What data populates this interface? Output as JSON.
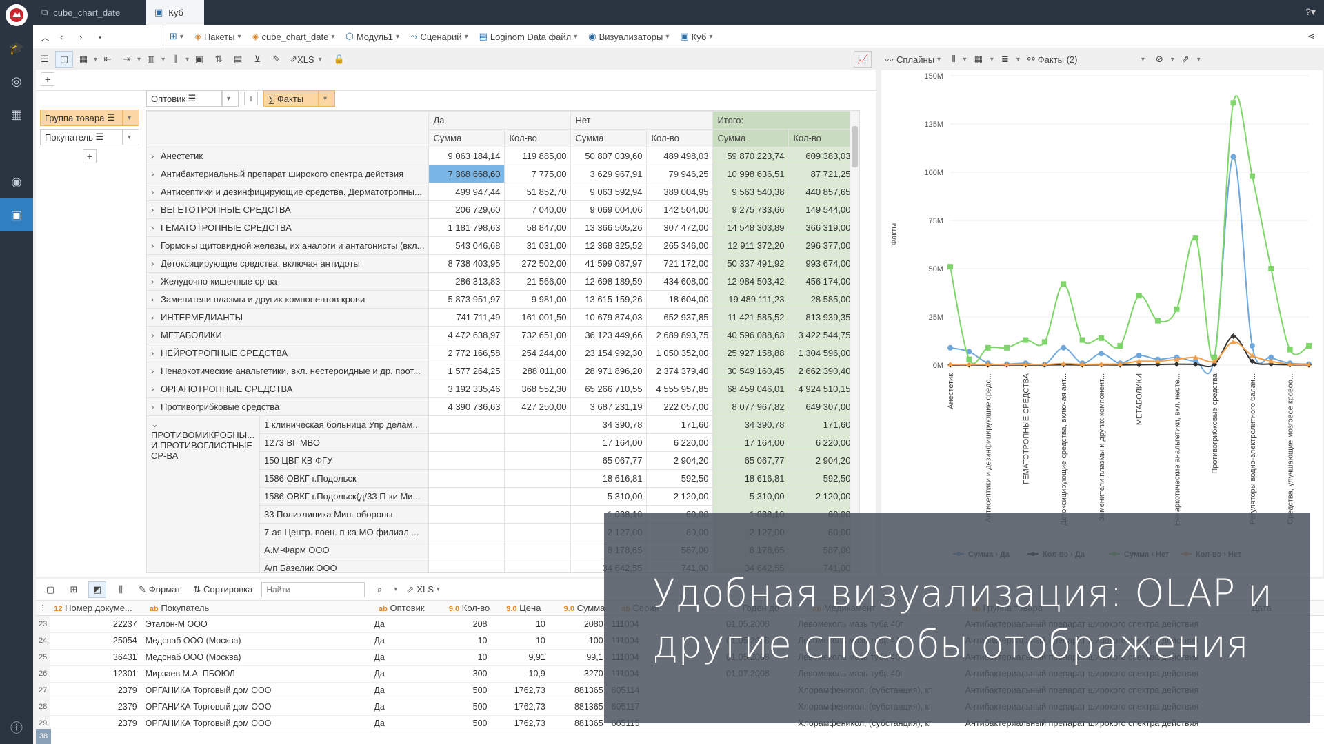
{
  "tabs": [
    {
      "label": "cube_chart_date"
    },
    {
      "label": "Куб"
    }
  ],
  "breadcrumbs": [
    {
      "label": "Пакеты",
      "icon": "package-icon"
    },
    {
      "label": "cube_chart_date",
      "icon": "package-icon"
    },
    {
      "label": "Модуль1",
      "icon": "module-icon"
    },
    {
      "label": "Сценарий",
      "icon": "scenario-icon"
    },
    {
      "label": "Loginom Data файл",
      "icon": "file-icon"
    },
    {
      "label": "Визуализаторы",
      "icon": "eye-icon"
    },
    {
      "label": "Куб",
      "icon": "cube-icon"
    }
  ],
  "toolbar2": {
    "xls": "XLS"
  },
  "pivot": {
    "filters": {
      "optovik": "Оптовик",
      "facts": "∑ Факты"
    },
    "row_dims": {
      "group": "Группа товара",
      "buyer": "Покупатель"
    },
    "col_groups": [
      "Да",
      "Нет",
      "Итого:"
    ],
    "measures": [
      "Сумма",
      "Кол-во",
      "Сумма",
      "Кол-во",
      "Сумма",
      "Кол-во"
    ],
    "rows": [
      {
        "label": "Анестетик",
        "v": [
          "9 063 184,14",
          "119 885,00",
          "50 807 039,60",
          "489 498,03",
          "59 870 223,74",
          "609 383,03"
        ]
      },
      {
        "label": "Антибактериальный препарат широкого спектра действия",
        "v": [
          "7 368 668,60",
          "7 775,00",
          "3 629 967,91",
          "79 946,25",
          "10 998 636,51",
          "87 721,25"
        ],
        "sel": true
      },
      {
        "label": "Антисептики и дезинфицирующие средства. Дерматотропны...",
        "v": [
          "499 947,44",
          "51 852,70",
          "9 063 592,94",
          "389 004,95",
          "9 563 540,38",
          "440 857,65"
        ]
      },
      {
        "label": "ВЕГЕТОТРОПНЫЕ СРЕДСТВА",
        "v": [
          "206 729,60",
          "7 040,00",
          "9 069 004,06",
          "142 504,00",
          "9 275 733,66",
          "149 544,00"
        ]
      },
      {
        "label": "ГЕМАТОТРОПНЫЕ СРЕДСТВА",
        "v": [
          "1 181 798,63",
          "58 847,00",
          "13 366 505,26",
          "307 472,00",
          "14 548 303,89",
          "366 319,00"
        ]
      },
      {
        "label": "Гормоны щитовидной железы, их аналоги и антагонисты (вкл...",
        "v": [
          "543 046,68",
          "31 031,00",
          "12 368 325,52",
          "265 346,00",
          "12 911 372,20",
          "296 377,00"
        ]
      },
      {
        "label": "Детоксицирующие средства, включая антидоты",
        "v": [
          "8 738 403,95",
          "272 502,00",
          "41 599 087,97",
          "721 172,00",
          "50 337 491,92",
          "993 674,00"
        ]
      },
      {
        "label": "Желудочно-кишечные ср-ва",
        "v": [
          "286 313,83",
          "21 566,00",
          "12 698 189,59",
          "434 608,00",
          "12 984 503,42",
          "456 174,00"
        ]
      },
      {
        "label": "Заменители плазмы и других компонентов крови",
        "v": [
          "5 873 951,97",
          "9 981,00",
          "13 615 159,26",
          "18 604,00",
          "19 489 111,23",
          "28 585,00"
        ]
      },
      {
        "label": "ИНТЕРМЕДИАНТЫ",
        "v": [
          "741 711,49",
          "161 001,50",
          "10 679 874,03",
          "652 937,85",
          "11 421 585,52",
          "813 939,35"
        ]
      },
      {
        "label": "МЕТАБОЛИКИ",
        "v": [
          "4 472 638,97",
          "732 651,00",
          "36 123 449,66",
          "2 689 893,75",
          "40 596 088,63",
          "3 422 544,75"
        ]
      },
      {
        "label": "НЕЙРОТРОПНЫЕ СРЕДСТВА",
        "v": [
          "2 772 166,58",
          "254 244,00",
          "23 154 992,30",
          "1 050 352,00",
          "25 927 158,88",
          "1 304 596,00"
        ]
      },
      {
        "label": "Ненаркотические анальгетики, вкл. нестероидные и др. прот...",
        "v": [
          "1 577 264,25",
          "288 011,00",
          "28 971 896,20",
          "2 374 379,40",
          "30 549 160,45",
          "2 662 390,40"
        ]
      },
      {
        "label": "ОРГАНОТРОПНЫЕ СРЕДСТВА",
        "v": [
          "3 192 335,46",
          "368 552,30",
          "65 266 710,55",
          "4 555 957,85",
          "68 459 046,01",
          "4 924 510,15"
        ]
      },
      {
        "label": "Противогрибковые средства",
        "v": [
          "4 390 736,63",
          "427 250,00",
          "3 687 231,19",
          "222 057,00",
          "8 077 967,82",
          "649 307,00"
        ]
      }
    ],
    "expanded_group": "ПРОТИВОМИКРОБНЫ... И ПРОТИВОГЛИСТНЫЕ СР-ВА",
    "sub_rows": [
      {
        "label": "1 клиническая больница Упр делам...",
        "v": [
          "",
          "",
          "34 390,78",
          "171,60",
          "34 390,78",
          "171,60"
        ]
      },
      {
        "label": "1273 ВГ МВО",
        "v": [
          "",
          "",
          "17 164,00",
          "6 220,00",
          "17 164,00",
          "6 220,00"
        ]
      },
      {
        "label": "150 ЦВГ КВ ФГУ",
        "v": [
          "",
          "",
          "65 067,77",
          "2 904,20",
          "65 067,77",
          "2 904,20"
        ]
      },
      {
        "label": "1586 ОВКГ г.Подольск",
        "v": [
          "",
          "",
          "18 616,81",
          "592,50",
          "18 616,81",
          "592,50"
        ]
      },
      {
        "label": "1586 ОВКГ г.Подольск(д/33 П-ки Ми...",
        "v": [
          "",
          "",
          "5 310,00",
          "2 120,00",
          "5 310,00",
          "2 120,00"
        ]
      },
      {
        "label": "33 Поликлиника Мин. обороны",
        "v": [
          "",
          "",
          "1 038,10",
          "60,00",
          "1 038,10",
          "60,00"
        ]
      },
      {
        "label": "7-ая Центр. воен. п-ка МО филиал ...",
        "v": [
          "",
          "",
          "2 127,00",
          "60,00",
          "2 127,00",
          "60,00"
        ]
      },
      {
        "label": "А.М-Фарм ООО",
        "v": [
          "",
          "",
          "8 178,65",
          "587,00",
          "8 178,65",
          "587,00"
        ]
      },
      {
        "label": "А/п Базелик ООО",
        "v": [
          "",
          "",
          "34 642,55",
          "741,00",
          "34 642,55",
          "741,00"
        ]
      }
    ]
  },
  "chart_toolbar": {
    "type_label": "Сплайны",
    "facts_label": "Факты (2)"
  },
  "chart_data": {
    "type": "line",
    "ylabel": "Факты",
    "ylim": [
      0,
      150000000
    ],
    "y_ticks": [
      "0M",
      "25M",
      "50M",
      "75M",
      "100M",
      "125M",
      "150M"
    ],
    "categories": [
      "Анестетик",
      "",
      "Антисептики и дезинфицирующие средс...",
      "",
      "ГЕМАТОТРОПНЫЕ СРЕДСТВА",
      "",
      "Детоксицирующие средства, включая ант...",
      "",
      "Заменители плазмы и других компонент...",
      "",
      "МЕТАБОЛИКИ",
      "",
      "Ненаркотические анальгетики, вкл. несте...",
      "",
      "Противогрибковые средства",
      "",
      "Регуляторы водно-электролитного балан...",
      "",
      "Средства, улучшающие мозговое кровоо...",
      ""
    ],
    "series": [
      {
        "name": "Сумма › Да",
        "color": "#6fa8dc",
        "values": [
          9,
          7,
          1,
          0.5,
          1,
          0.3,
          9,
          1,
          6,
          1,
          5,
          3,
          4,
          2,
          4,
          108,
          10,
          4,
          1,
          0.5
        ]
      },
      {
        "name": "Кол-во › Да",
        "color": "#333333",
        "values": [
          0.1,
          0.1,
          0.1,
          0.1,
          0.1,
          0.1,
          0.2,
          0.1,
          0.2,
          0.1,
          0.2,
          0.3,
          0.5,
          0.4,
          0.3,
          15,
          2,
          0.5,
          0.2,
          0.1
        ]
      },
      {
        "name": "Сумма › Нет",
        "color": "#7ed66a",
        "values": [
          51,
          3,
          9,
          9,
          13,
          12,
          42,
          13,
          14,
          10,
          36,
          23,
          29,
          66,
          4,
          136,
          98,
          50,
          8,
          10
        ]
      },
      {
        "name": "Кол-во › Нет",
        "color": "#f0a04b",
        "values": [
          0.4,
          0.3,
          0.4,
          0.3,
          0.4,
          0.3,
          0.8,
          0.4,
          0.5,
          0.6,
          2,
          2,
          3,
          4,
          2,
          12,
          5,
          2,
          0.5,
          0.3
        ]
      }
    ]
  },
  "bottom": {
    "format": "Формат",
    "sort": "Сортировка",
    "search_placeholder": "Найти",
    "xls": "XLS",
    "columns": [
      "Номер докуме...",
      "Покупатель",
      "Оптовик",
      "Кол-во",
      "Цена",
      "Сумма",
      "Серия",
      "Годен до",
      "Медикамент",
      "Группа товара",
      "Дата"
    ],
    "col_types": [
      "12",
      "ab",
      "ab",
      "9.0",
      "9.0",
      "9.0",
      "ab",
      "",
      "ab",
      "ab",
      ""
    ],
    "rows": [
      {
        "n": "23",
        "doc": "22237",
        "buyer": "Эталон-М ООО",
        "opt": "Да",
        "qty": "208",
        "price": "10",
        "sum": "2080",
        "ser": "111004",
        "exp": "01.05.2008",
        "med": "Левомеколь мазь туба 40г",
        "grp": "Антибактериальный препарат широкого спектра действия"
      },
      {
        "n": "24",
        "doc": "25054",
        "buyer": "Медснаб ООО (Москва)",
        "opt": "Да",
        "qty": "10",
        "price": "10",
        "sum": "100",
        "ser": "111004",
        "exp": "01.05.2008",
        "med": "Левомеколь мазь туба 40г",
        "grp": "Антибактериальный препарат широкого спектра действия"
      },
      {
        "n": "25",
        "doc": "36431",
        "buyer": "Медснаб ООО (Москва)",
        "opt": "Да",
        "qty": "10",
        "price": "9,91",
        "sum": "99,1",
        "ser": "111004",
        "exp": "01.05.2008",
        "med": "Левомеколь мазь туба 40г",
        "grp": "Антибактериальный препарат широкого спектра действия"
      },
      {
        "n": "26",
        "doc": "12301",
        "buyer": "Мирзаев М.А. ПБОЮЛ",
        "opt": "Да",
        "qty": "300",
        "price": "10,9",
        "sum": "3270",
        "ser": "111004",
        "exp": "01.07.2008",
        "med": "Левомеколь мазь туба 40г",
        "grp": "Антибактериальный препарат широкого спектра действия"
      },
      {
        "n": "27",
        "doc": "2379",
        "buyer": "ОРГАНИКА Торговый дом ООО",
        "opt": "Да",
        "qty": "500",
        "price": "1762,73",
        "sum": "881365",
        "ser": "605114",
        "exp": "",
        "med": "Хлорамфеникол, (субстанция), кг",
        "grp": "Антибактериальный препарат широкого спектра действия"
      },
      {
        "n": "28",
        "doc": "2379",
        "buyer": "ОРГАНИКА Торговый дом ООО",
        "opt": "Да",
        "qty": "500",
        "price": "1762,73",
        "sum": "881365",
        "ser": "605117",
        "exp": "",
        "med": "Хлорамфеникол, (субстанция), кг",
        "grp": "Антибактериальный препарат широкого спектра действия"
      },
      {
        "n": "29",
        "doc": "2379",
        "buyer": "ОРГАНИКА Торговый дом ООО",
        "opt": "Да",
        "qty": "500",
        "price": "1762,73",
        "sum": "881365",
        "ser": "605115",
        "exp": "",
        "med": "Хлорамфеникол, (субстанция), кг",
        "grp": "Антибактериальный препарат широкого спектра действия"
      }
    ],
    "total_rows": "38"
  },
  "overlay": {
    "line1": "Удобная визуализация: OLAP и",
    "line2": "другие способы отображения"
  }
}
